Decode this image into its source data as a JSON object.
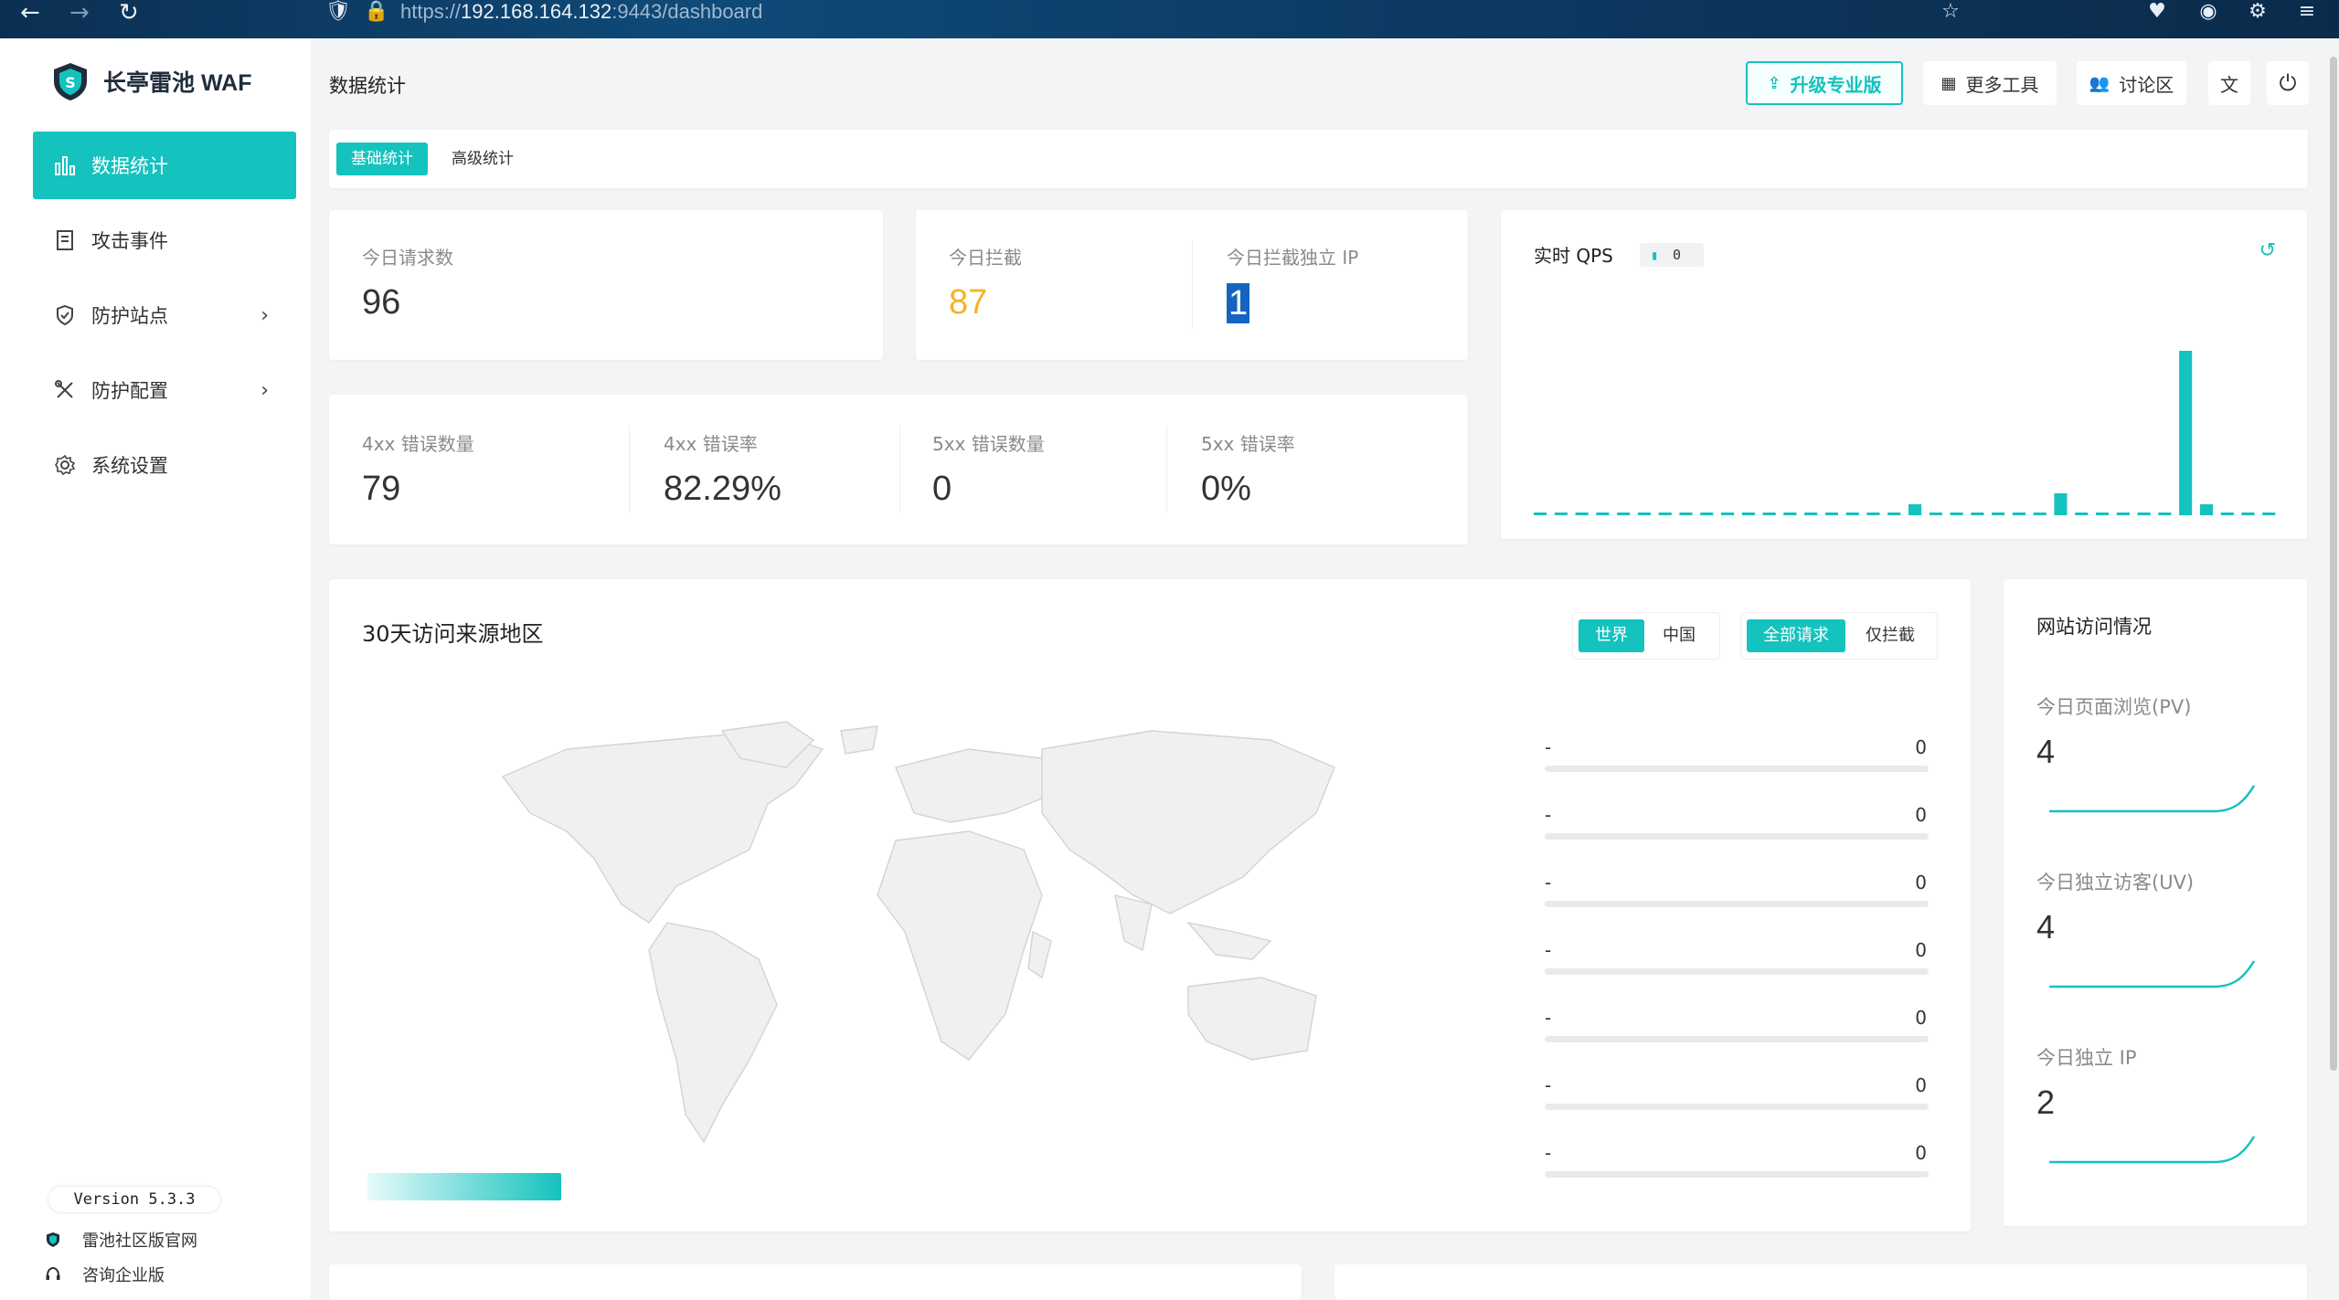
{
  "browser": {
    "url_prefix": "https://",
    "url_host": "192.168.164.132",
    "url_rest": ":9443/dashboard"
  },
  "app": {
    "name": "长亭雷池 WAF",
    "version": "Version 5.3.3",
    "accent": "#14c2be"
  },
  "sidebar": {
    "items": [
      {
        "label": "数据统计",
        "icon": "bar-chart-icon",
        "active": true
      },
      {
        "label": "攻击事件",
        "icon": "document-icon"
      },
      {
        "label": "防护站点",
        "icon": "shield-icon",
        "has_children": true
      },
      {
        "label": "防护配置",
        "icon": "tools-icon",
        "has_children": true
      },
      {
        "label": "系统设置",
        "icon": "gear-icon"
      }
    ],
    "links": [
      {
        "label": "雷池社区版官网",
        "icon": "shield-small-icon"
      },
      {
        "label": "咨询企业版",
        "icon": "headset-icon"
      }
    ]
  },
  "header": {
    "title": "数据统计",
    "buttons": {
      "upgrade": "升级专业版",
      "more_tools": "更多工具",
      "forum": "讨论区"
    }
  },
  "tabs": [
    "基础统计",
    "高级统计"
  ],
  "stats": {
    "today_requests_label": "今日请求数",
    "today_requests": "96",
    "today_blocked_label": "今日拦截",
    "today_blocked": "87",
    "blocked_ip_label": "今日拦截独立 IP",
    "blocked_ip": "1",
    "err4xx_count_label": "4xx 错误数量",
    "err4xx_count": "79",
    "err4xx_rate_label": "4xx 错误率",
    "err4xx_rate": "82.29%",
    "err5xx_count_label": "5xx 错误数量",
    "err5xx_count": "0",
    "err5xx_rate_label": "5xx 错误率",
    "err5xx_rate": "0%"
  },
  "qps": {
    "title": "实时 QPS",
    "badge": "0",
    "bars": [
      0,
      0,
      0,
      0,
      0,
      0,
      0,
      0,
      0,
      0,
      0,
      0,
      0,
      0,
      0,
      0,
      0,
      0,
      1,
      0,
      0,
      0,
      0,
      0,
      0,
      2,
      0,
      0,
      0,
      0,
      0,
      15,
      1,
      0,
      0,
      0
    ]
  },
  "geo": {
    "title": "30天访问来源地区",
    "region_options": [
      "世界",
      "中国"
    ],
    "filter_options": [
      "全部请求",
      "仅拦截"
    ],
    "ranking": [
      {
        "name": "-",
        "value": "0"
      },
      {
        "name": "-",
        "value": "0"
      },
      {
        "name": "-",
        "value": "0"
      },
      {
        "name": "-",
        "value": "0"
      },
      {
        "name": "-",
        "value": "0"
      },
      {
        "name": "-",
        "value": "0"
      },
      {
        "name": "-",
        "value": "0"
      }
    ]
  },
  "site_access": {
    "title": "网站访问情况",
    "pv_label": "今日页面浏览(PV)",
    "pv": "4",
    "uv_label": "今日独立访客(UV)",
    "uv": "4",
    "ip_label": "今日独立 IP",
    "ip": "2"
  }
}
